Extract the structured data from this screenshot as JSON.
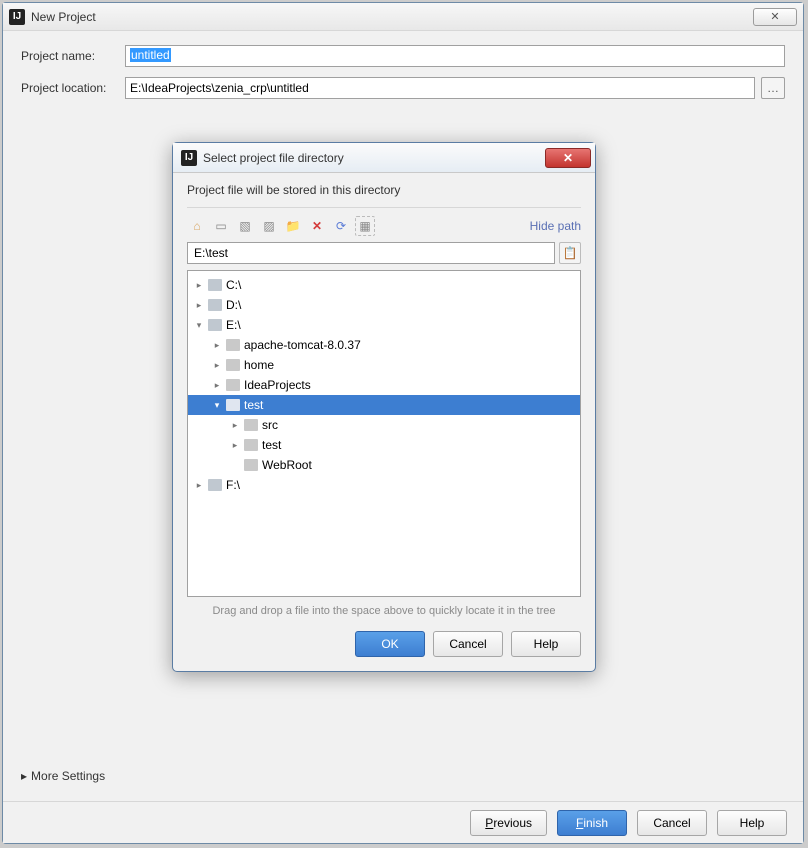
{
  "window": {
    "title": "New Project",
    "close_glyph": "✕"
  },
  "form": {
    "name_label": "Project name:",
    "name_value": "untitled",
    "location_label": "Project location:",
    "location_value": "E:\\IdeaProjects\\zenia_crp\\untitled",
    "browse_glyph": "…"
  },
  "more_settings": {
    "label": "More Settings",
    "arrow": "▸"
  },
  "footer": {
    "previous": "Previous",
    "finish": "Finish",
    "cancel": "Cancel",
    "help": "Help"
  },
  "modal": {
    "title": "Select project file directory",
    "close_glyph": "✕",
    "desc": "Project file will be stored in this directory",
    "hide_path": "Hide path",
    "hint": "Drag and drop a file into the space above to quickly locate it in the tree",
    "path_value": "E:\\test",
    "toolbar_icons": {
      "home": "⌂",
      "project": "▭",
      "collapse1": "▧",
      "collapse2": "▨",
      "newfolder": "📁",
      "delete": "✕",
      "refresh": "⟳",
      "showhidden": "▦"
    },
    "buttons": {
      "ok": "OK",
      "cancel": "Cancel",
      "help": "Help"
    },
    "tree": [
      {
        "level": 0,
        "arrow": "▸",
        "label": "C:\\",
        "drive": true
      },
      {
        "level": 0,
        "arrow": "▸",
        "label": "D:\\",
        "drive": true
      },
      {
        "level": 0,
        "arrow": "▾",
        "label": "E:\\",
        "drive": true
      },
      {
        "level": 1,
        "arrow": "▸",
        "label": "apache-tomcat-8.0.37"
      },
      {
        "level": 1,
        "arrow": "▸",
        "label": "home"
      },
      {
        "level": 1,
        "arrow": "▸",
        "label": "IdeaProjects"
      },
      {
        "level": 1,
        "arrow": "▾",
        "label": "test",
        "selected": true
      },
      {
        "level": 2,
        "arrow": "▸",
        "label": "src"
      },
      {
        "level": 2,
        "arrow": "▸",
        "label": "test"
      },
      {
        "level": 2,
        "arrow": "",
        "label": "WebRoot"
      },
      {
        "level": 0,
        "arrow": "▸",
        "label": "F:\\",
        "drive": true
      }
    ]
  }
}
